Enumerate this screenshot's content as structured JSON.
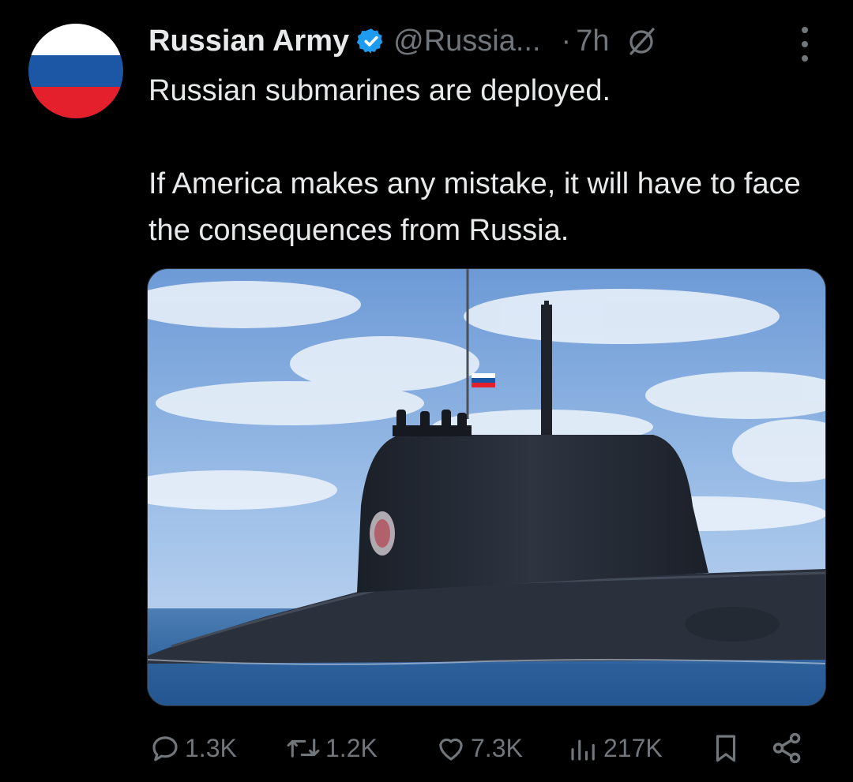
{
  "avatar": {
    "icon": "russian-flag-avatar",
    "colors": [
      "#ffffff",
      "#1c57a5",
      "#e4202d"
    ]
  },
  "author": {
    "name": "Russian Army",
    "verified": true,
    "handle": "@Russia...",
    "separator": "·",
    "time": "7h"
  },
  "tweet": {
    "lines": [
      "Russian submarines are deployed.",
      "If America makes any mistake, it will have to face the consequences from Russia."
    ]
  },
  "media": {
    "kind": "photo",
    "subject": "submarine-with-russian-flag"
  },
  "actions": {
    "replies": "1.3K",
    "reposts": "1.2K",
    "likes": "7.3K",
    "views": "217K"
  },
  "colors": {
    "background": "#000000",
    "text": "#e7e9ea",
    "muted": "#71767b",
    "verified": "#1d9bf0"
  }
}
